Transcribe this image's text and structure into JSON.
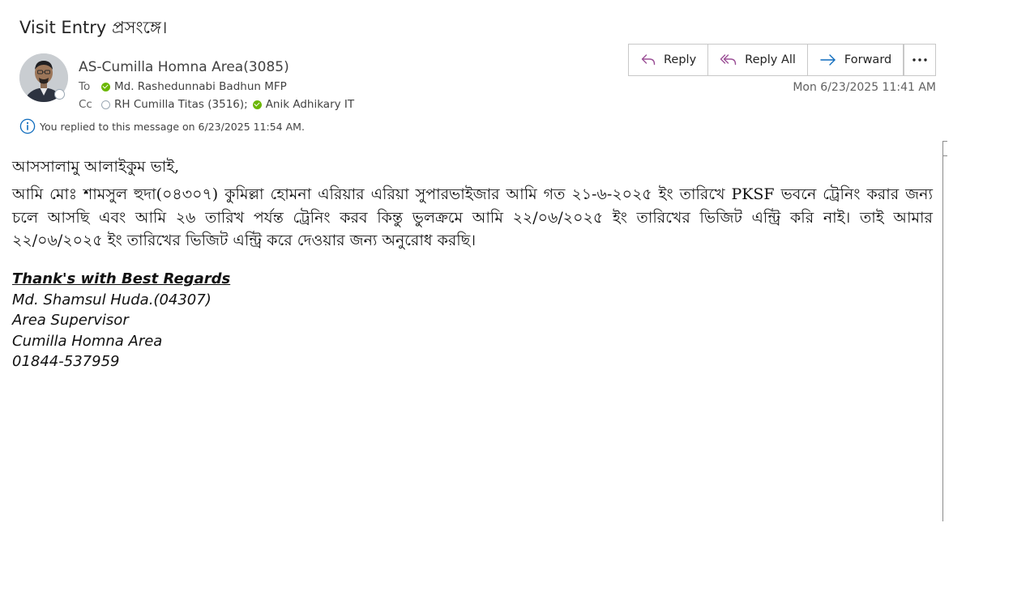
{
  "email": {
    "subject": "Visit Entry প্রসংঙ্গে।",
    "sender": "AS-Cumilla Homna Area(3085)",
    "to_label": "To",
    "to": [
      {
        "name": "Md. Rashedunnabi Badhun MFP",
        "status": "available"
      }
    ],
    "cc_label": "Cc",
    "cc": [
      {
        "name": "RH Cumilla Titas (3516);",
        "status": "offline"
      },
      {
        "name": "Anik Adhikary IT",
        "status": "available"
      }
    ],
    "info_text": "You replied to this message on 6/23/2025 11:54 AM.",
    "timestamp": "Mon 6/23/2025 11:41 AM"
  },
  "toolbar": {
    "reply_label": "Reply",
    "reply_all_label": "Reply All",
    "forward_label": "Forward",
    "more_icon": "more-horizontal-icon",
    "accent_color": "#9b4f96",
    "forward_color": "#0f6cbd"
  },
  "body": {
    "greeting": "আসসালামু আলাইকুম ভাই,",
    "paragraph": "আমি মোঃ শামসুল হুদা(০৪৩০৭) কুমিল্লা হোমনা এরিয়ার এরিয়া সুপারভাইজার আমি গত ২১-৬-২০২৫ ইং তারিখে PKSF ভবনে ট্রেনিং করার জন্য চলে আসছি এবং আমি ২৬ তারিখ পর্যন্ত ট্রেনিং করব কিন্তু ভুলক্রমে আমি ২২/০৬/২০২৫ ইং তারিখের ভিজিট এন্ট্রি করি নাই। তাই আমার ২২/০৬/২০২৫ ইং তারিখের ভিজিট এন্ট্রি করে দেওয়ার জন্য অনুরোধ করছি।"
  },
  "signature": {
    "regards": "Thank's with Best Regards",
    "name": "Md. Shamsul Huda.(04307)",
    "title": "Area Supervisor",
    "area": "Cumilla Homna Area",
    "phone": "01844-537959"
  }
}
